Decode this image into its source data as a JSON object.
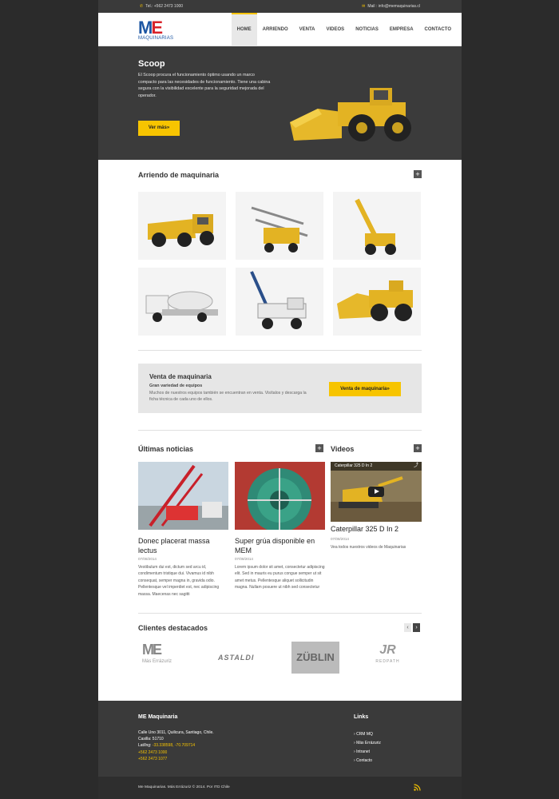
{
  "topbar": {
    "phone": "Tel.: +562 2473 1000",
    "mail": "Mail : info@memaquinarias.cl"
  },
  "brand": {
    "logo_letters": "ME",
    "logo_sub": "MAQUINARIAS"
  },
  "menu": {
    "items": [
      "HOME",
      "ARRIENDO",
      "VENTA",
      "VIDEOS",
      "NOTICIAS",
      "EMPRESA",
      "CONTACTO"
    ],
    "active": "HOME"
  },
  "hero": {
    "title": "Scoop",
    "text": "El Scoop procura el funcionamiento óptimo usando un marco compacto para las necesidades de funcionamiento. Tiene una cabina segura con la visibilidad excelente para la seguridad mejorada del operador.",
    "button": "Ver más»"
  },
  "arriendo": {
    "title": "Arriendo de maquinaria",
    "plus": "+"
  },
  "venta": {
    "title": "Venta de maquinaria",
    "subtitle": "Gran variedad de equipos",
    "text": "Muchos de nuestros equipos también se encuentran en venta. Visítalos y descarga la ficha técnica de cada uno de ellos.",
    "button": "Venta de maquinaria»"
  },
  "noticias": {
    "title": "Últimas noticias",
    "plus": "+",
    "items": [
      {
        "title": "Donec placerat massa lectus",
        "date": "07/08/2014",
        "text": "Vestibulum dui est, dictum sed arcu id, condimentum tristique dui. Vivamus id nibh consequat, semper magna in, gravida odio. Pellentesque vel imperdiet est, nec adipiscing massa. Maecenas nec sagitti"
      },
      {
        "title": "Super grúa disponible en MEM",
        "date": "07/08/2014",
        "text": "Lorem ipsum dolor sit amet, consectetur adipiscing elit. Sed in mauris eu purus congue semper ut sit amet metus. Pellentesque aliquet sollicitudin magna. Nullam posuere ut nibh sed consectetur"
      }
    ]
  },
  "videos": {
    "title": "Videos",
    "plus": "+",
    "video_bar": "Caterpillar 325 D In 2",
    "video_title": "Caterpillar 325 D In 2",
    "date": "07/08/2014",
    "link": "Vea todos nuestros videos de Maquinarias"
  },
  "clientes": {
    "title": "Clientes destacados",
    "logos": [
      "ME",
      "Más Errázuriz",
      "ASTALDI",
      "ZÜBLIN",
      "REDPATH"
    ],
    "prev": "‹",
    "next": "›"
  },
  "footer": {
    "title": "ME Maquinaria",
    "address": "Calle Uno 3011, Quilicura, Santiago, Chile.",
    "casilla": "Casilla: 51710",
    "latlng_label": "Lat/lng: ",
    "latlng": "-33.338598, -70.709714",
    "phone1": "+562 2473 1000",
    "phone2": "+562 2473 1077",
    "links_title": "Links",
    "links": [
      "CRM MQ",
      "Más Errázuriz",
      "Intranet",
      "Contacto"
    ],
    "copyright": "Me Maquinarias. Más Errázuriz © 2014. Por ITD Chile"
  },
  "colors": {
    "accent": "#f7c400",
    "dark": "#3b3b3b",
    "brand_blue": "#1d56a3",
    "brand_red": "#d8232a"
  }
}
